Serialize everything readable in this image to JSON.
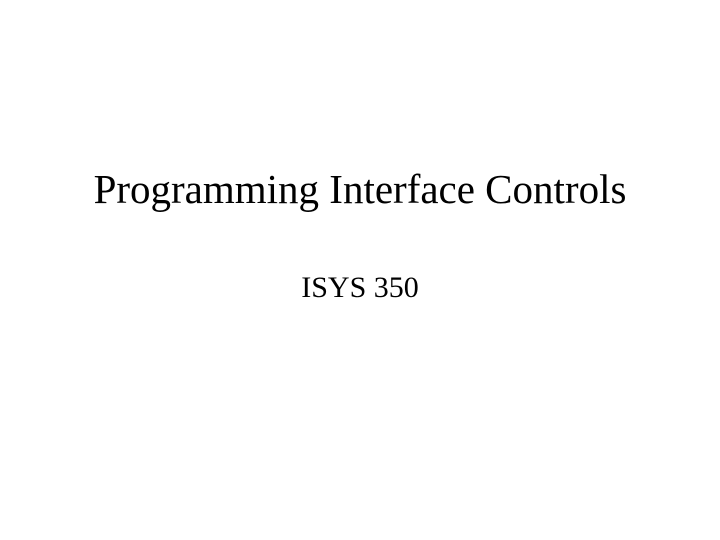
{
  "slide": {
    "title": "Programming Interface Controls",
    "subtitle": "ISYS 350"
  }
}
